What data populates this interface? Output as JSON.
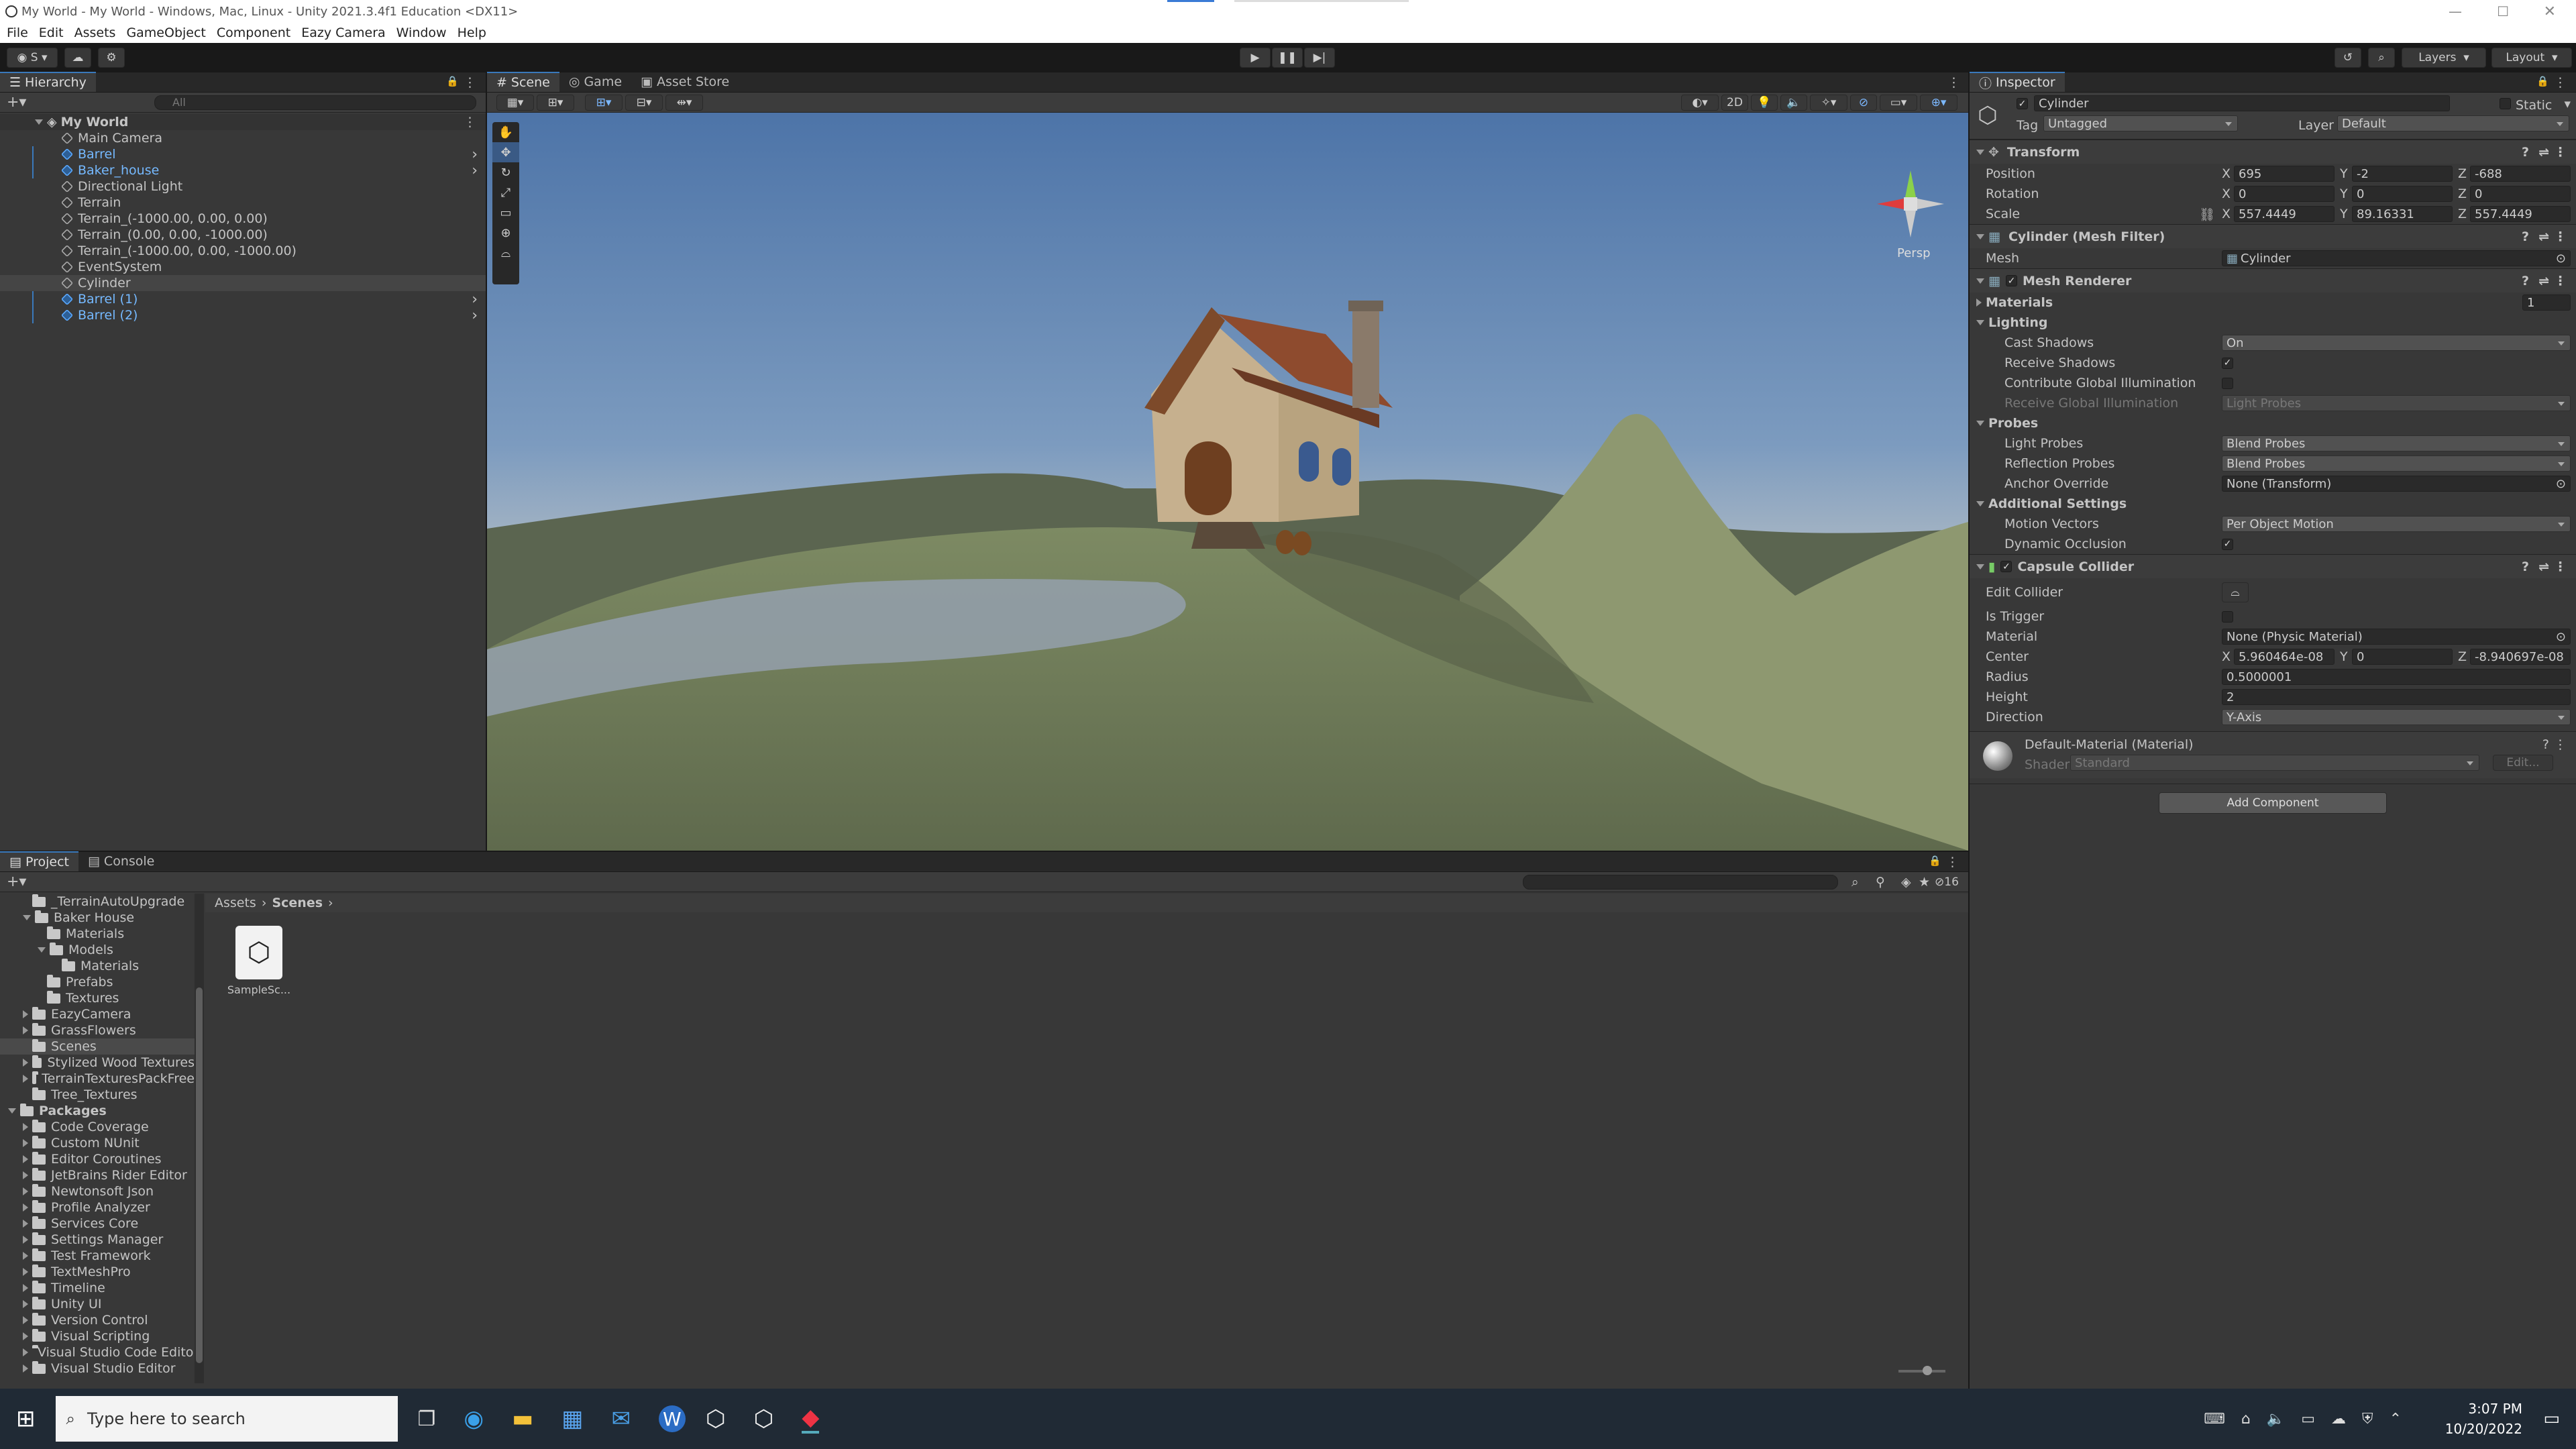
{
  "window": {
    "title": "My World - My World - Windows, Mac, Linux - Unity 2021.3.4f1 Education <DX11>"
  },
  "menu": [
    "File",
    "Edit",
    "Assets",
    "GameObject",
    "Component",
    "Eazy Camera",
    "Window",
    "Help"
  ],
  "toolbar": {
    "account": "S",
    "layers": "Layers",
    "layout": "Layout"
  },
  "hierarchy": {
    "tab": "Hierarchy",
    "search_placeholder": "All",
    "scene": "My World",
    "items": [
      {
        "label": "Main Camera",
        "prefab": false,
        "expand": false
      },
      {
        "label": "Barrel",
        "prefab": true,
        "expand": true
      },
      {
        "label": "Baker_house",
        "prefab": true,
        "expand": true
      },
      {
        "label": "Directional Light",
        "prefab": false,
        "expand": false
      },
      {
        "label": "Terrain",
        "prefab": false,
        "expand": false
      },
      {
        "label": "Terrain_(-1000.00, 0.00, 0.00)",
        "prefab": false,
        "expand": false
      },
      {
        "label": "Terrain_(0.00, 0.00, -1000.00)",
        "prefab": false,
        "expand": false
      },
      {
        "label": "Terrain_(-1000.00, 0.00, -1000.00)",
        "prefab": false,
        "expand": false
      },
      {
        "label": "EventSystem",
        "prefab": false,
        "expand": false
      },
      {
        "label": "Cylinder",
        "prefab": false,
        "expand": false,
        "selected": true
      },
      {
        "label": "Barrel (1)",
        "prefab": true,
        "expand": true
      },
      {
        "label": "Barrel (2)",
        "prefab": true,
        "expand": true
      }
    ]
  },
  "scene_tabs": {
    "scene": "Scene",
    "game": "Game",
    "store": "Asset Store",
    "btn_2d": "2D",
    "persp": "Persp"
  },
  "inspector": {
    "tab": "Inspector",
    "object_name": "Cylinder",
    "static": "Static",
    "tag_label": "Tag",
    "tag": "Untagged",
    "layer_label": "Layer",
    "layer": "Default",
    "transform": {
      "title": "Transform",
      "position": {
        "label": "Position",
        "x": "695",
        "y": "-2",
        "z": "-688"
      },
      "rotation": {
        "label": "Rotation",
        "x": "0",
        "y": "0",
        "z": "0"
      },
      "scale": {
        "label": "Scale",
        "x": "557.4449",
        "y": "89.16331",
        "z": "557.4449"
      }
    },
    "mesh_filter": {
      "title": "Cylinder (Mesh Filter)",
      "mesh_label": "Mesh",
      "mesh": "Cylinder"
    },
    "mesh_renderer": {
      "title": "Mesh Renderer",
      "materials": "Materials",
      "materials_count": "1",
      "lighting": "Lighting",
      "cast_shadows": "Cast Shadows",
      "cast_shadows_val": "On",
      "receive_shadows": "Receive Shadows",
      "contribute_gi": "Contribute Global Illumination",
      "receive_gi": "Receive Global Illumination",
      "receive_gi_val": "Light Probes",
      "probes": "Probes",
      "light_probes": "Light Probes",
      "light_probes_val": "Blend Probes",
      "reflection_probes": "Reflection Probes",
      "reflection_probes_val": "Blend Probes",
      "anchor_override": "Anchor Override",
      "anchor_override_val": "None (Transform)",
      "additional": "Additional Settings",
      "motion_vectors": "Motion Vectors",
      "motion_vectors_val": "Per Object Motion",
      "dynamic_occlusion": "Dynamic Occlusion"
    },
    "capsule": {
      "title": "Capsule Collider",
      "edit_collider": "Edit Collider",
      "is_trigger": "Is Trigger",
      "material": "Material",
      "material_val": "None (Physic Material)",
      "center": "Center",
      "cx": "5.960464e-08",
      "cy": "0",
      "cz": "-8.940697e-08",
      "radius": "Radius",
      "radius_val": "0.5000001",
      "height": "Height",
      "height_val": "2",
      "direction": "Direction",
      "direction_val": "Y-Axis"
    },
    "material": {
      "name": "Default-Material (Material)",
      "shader_label": "Shader",
      "shader": "Standard",
      "edit": "Edit..."
    },
    "add_component": "Add Component"
  },
  "project": {
    "tab": "Project",
    "console_tab": "Console",
    "breadcrumb": [
      "Assets",
      "Scenes"
    ],
    "hidden_count": "16",
    "asset": "SampleSc...",
    "tree": [
      {
        "label": "_TerrainAutoUpgrade",
        "depth": 1,
        "exp": "none"
      },
      {
        "label": "Baker House",
        "depth": 1,
        "exp": "open"
      },
      {
        "label": "Materials",
        "depth": 2,
        "exp": "none"
      },
      {
        "label": "Models",
        "depth": 2,
        "exp": "open"
      },
      {
        "label": "Materials",
        "depth": 3,
        "exp": "none"
      },
      {
        "label": "Prefabs",
        "depth": 2,
        "exp": "none"
      },
      {
        "label": "Textures",
        "depth": 2,
        "exp": "none"
      },
      {
        "label": "EazyCamera",
        "depth": 1,
        "exp": "closed"
      },
      {
        "label": "GrassFlowers",
        "depth": 1,
        "exp": "closed"
      },
      {
        "label": "Scenes",
        "depth": 1,
        "exp": "none",
        "selected": true
      },
      {
        "label": "Stylized Wood Textures",
        "depth": 1,
        "exp": "closed"
      },
      {
        "label": "TerrainTexturesPackFree",
        "depth": 1,
        "exp": "closed"
      },
      {
        "label": "Tree_Textures",
        "depth": 1,
        "exp": "none"
      },
      {
        "label": "Packages",
        "depth": 0,
        "exp": "open",
        "bold": true
      },
      {
        "label": "Code Coverage",
        "depth": 1,
        "exp": "closed"
      },
      {
        "label": "Custom NUnit",
        "depth": 1,
        "exp": "closed"
      },
      {
        "label": "Editor Coroutines",
        "depth": 1,
        "exp": "closed"
      },
      {
        "label": "JetBrains Rider Editor",
        "depth": 1,
        "exp": "closed"
      },
      {
        "label": "Newtonsoft Json",
        "depth": 1,
        "exp": "closed"
      },
      {
        "label": "Profile Analyzer",
        "depth": 1,
        "exp": "closed"
      },
      {
        "label": "Services Core",
        "depth": 1,
        "exp": "closed"
      },
      {
        "label": "Settings Manager",
        "depth": 1,
        "exp": "closed"
      },
      {
        "label": "Test Framework",
        "depth": 1,
        "exp": "closed"
      },
      {
        "label": "TextMeshPro",
        "depth": 1,
        "exp": "closed"
      },
      {
        "label": "Timeline",
        "depth": 1,
        "exp": "closed"
      },
      {
        "label": "Unity UI",
        "depth": 1,
        "exp": "closed"
      },
      {
        "label": "Version Control",
        "depth": 1,
        "exp": "closed"
      },
      {
        "label": "Visual Scripting",
        "depth": 1,
        "exp": "closed"
      },
      {
        "label": "Visual Studio Code Editor",
        "depth": 1,
        "exp": "closed"
      },
      {
        "label": "Visual Studio Editor",
        "depth": 1,
        "exp": "closed"
      }
    ]
  },
  "taskbar": {
    "search_placeholder": "Type here to search",
    "time": "3:07 PM",
    "date": "10/20/2022"
  }
}
